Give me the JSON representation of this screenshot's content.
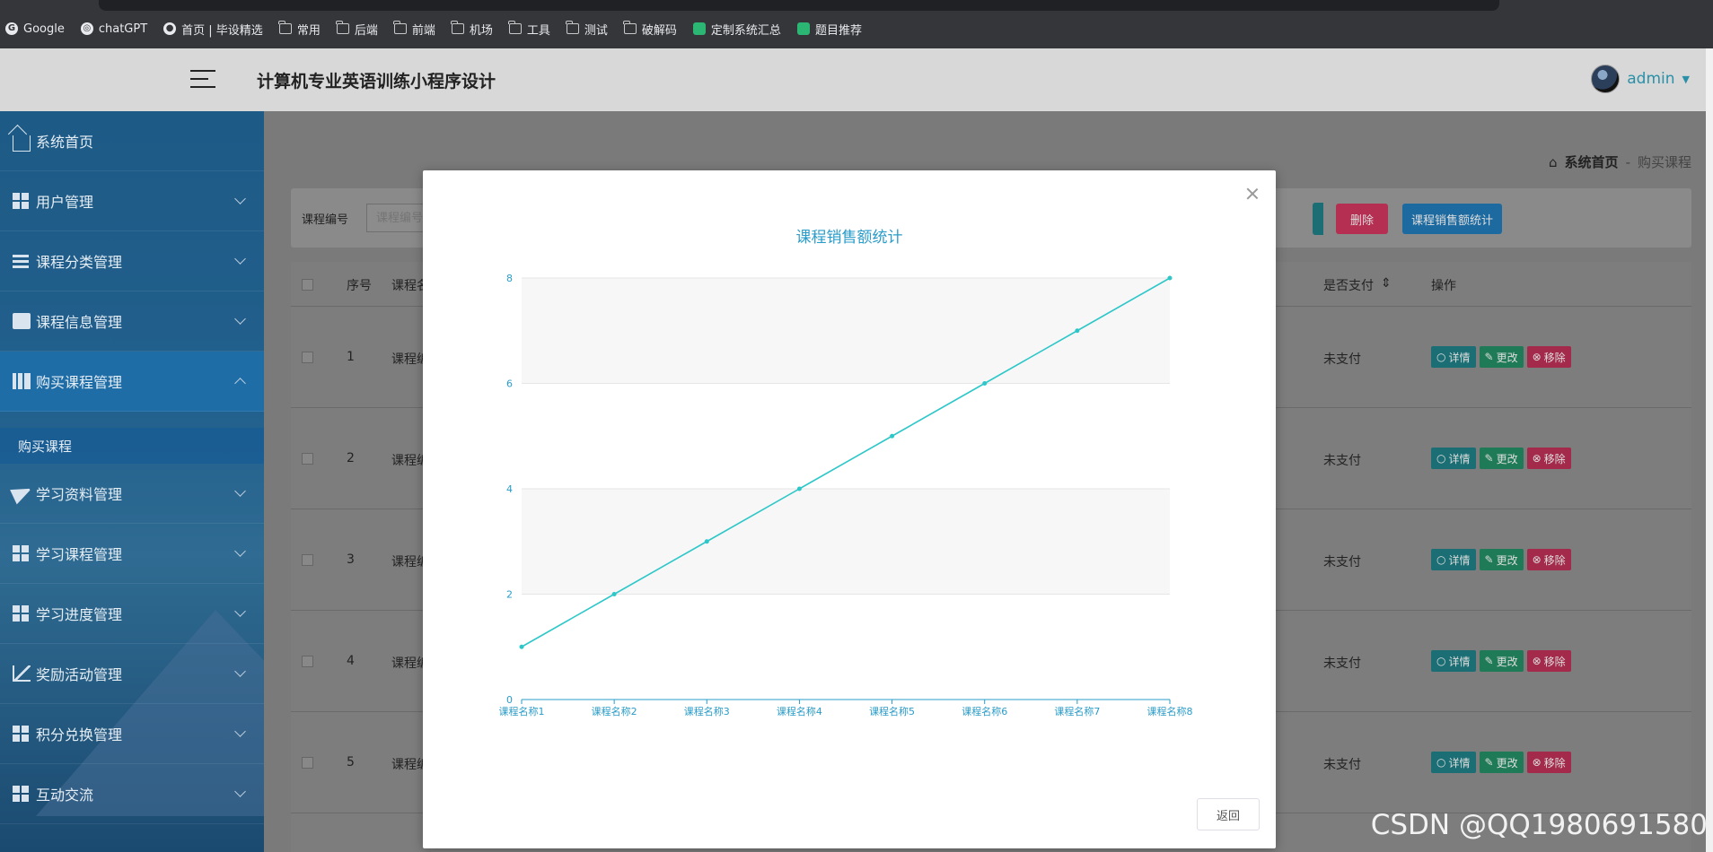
{
  "bookmarks": [
    {
      "label": "Google",
      "icon": "google-icon"
    },
    {
      "label": "chatGPT",
      "icon": "chatgpt-icon"
    },
    {
      "label": "首页 | 毕设精选",
      "icon": "site-icon"
    },
    {
      "label": "常用",
      "icon": "folder-icon"
    },
    {
      "label": "后端",
      "icon": "folder-icon"
    },
    {
      "label": "前端",
      "icon": "folder-icon"
    },
    {
      "label": "机场",
      "icon": "folder-icon"
    },
    {
      "label": "工具",
      "icon": "folder-icon"
    },
    {
      "label": "测试",
      "icon": "folder-icon"
    },
    {
      "label": "破解码",
      "icon": "folder-icon"
    },
    {
      "label": "定制系统汇总",
      "icon": "green-app-icon"
    },
    {
      "label": "题目推荐",
      "icon": "green-app-icon"
    }
  ],
  "header": {
    "title": "计算机专业英语训练小程序设计",
    "user": "admin"
  },
  "sidebar": {
    "items": [
      {
        "label": "系统首页",
        "icon": "home-icon"
      },
      {
        "label": "用户管理",
        "icon": "grid-icon"
      },
      {
        "label": "课程分类管理",
        "icon": "list-icon"
      },
      {
        "label": "课程信息管理",
        "icon": "clipboard-icon"
      },
      {
        "label": "购买课程管理",
        "icon": "books-icon"
      },
      {
        "label": "学习资料管理",
        "icon": "paper-plane-icon"
      },
      {
        "label": "学习课程管理",
        "icon": "grid-icon"
      },
      {
        "label": "学习进度管理",
        "icon": "grid-icon"
      },
      {
        "label": "奖励活动管理",
        "icon": "line-chart-icon"
      },
      {
        "label": "积分兑换管理",
        "icon": "grid-icon"
      },
      {
        "label": "互动交流",
        "icon": "grid-icon"
      }
    ],
    "sub_item": "购买课程"
  },
  "breadcrumb": {
    "home": "系统首页",
    "sep": "-",
    "current": "购买课程"
  },
  "search": {
    "label": "课程编号",
    "placeholder": "课程编号"
  },
  "actions": {
    "delete": "删除",
    "stats": "课程销售额统计"
  },
  "table": {
    "headers": {
      "index": "序号",
      "name": "课程名",
      "paid": "是否支付",
      "ops": "操作"
    },
    "rows": [
      {
        "index": "1",
        "name": "课程编",
        "paid": "未支付"
      },
      {
        "index": "2",
        "name": "课程编",
        "paid": "未支付"
      },
      {
        "index": "3",
        "name": "课程编",
        "paid": "未支付"
      },
      {
        "index": "4",
        "name": "课程编",
        "paid": "未支付"
      },
      {
        "index": "5",
        "name": "课程编",
        "paid": "未支付"
      }
    ],
    "op_labels": {
      "detail": "详情",
      "edit": "更改",
      "remove": "移除"
    }
  },
  "modal": {
    "back": "返回"
  },
  "chart_data": {
    "type": "line",
    "title": "课程销售额统计",
    "categories": [
      "课程名称1",
      "课程名称2",
      "课程名称3",
      "课程名称4",
      "课程名称5",
      "课程名称6",
      "课程名称7",
      "课程名称8"
    ],
    "values": [
      1,
      2,
      3,
      4,
      5,
      6,
      7,
      8
    ],
    "ylim": [
      0,
      8
    ],
    "yticks": [
      0,
      2,
      4,
      6,
      8
    ],
    "grid": true,
    "color": "#2ec7c9",
    "axis_color": "#2a9cc9"
  },
  "watermark": "CSDN @QQ1980691580"
}
